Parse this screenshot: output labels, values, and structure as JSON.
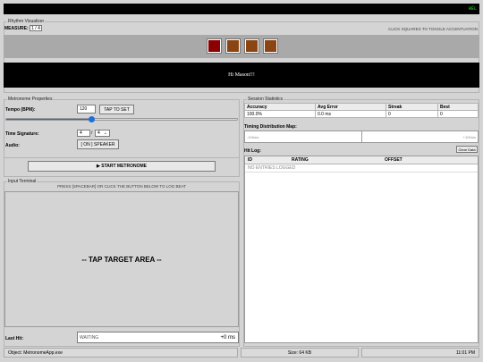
{
  "window": {
    "top_status": "RÉL"
  },
  "visualizer": {
    "title": "Rhythm Visualizer",
    "measure_label": "MEASURE:",
    "measure_value": "1 / 4",
    "hint": "CLICK SQUARES TO TOGGLE ACCENTUATION",
    "squares": [
      {
        "color": "#8b0000"
      },
      {
        "color": "#8b4513"
      },
      {
        "color": "#8b4513"
      },
      {
        "color": "#8b4513"
      }
    ],
    "message": "Hi Mason!!!"
  },
  "metronome": {
    "title": "Metronome Properties",
    "tempo_label": "Tempo (BPM):",
    "tempo_value": "120",
    "tap_label": "TAP TO SET",
    "tempo_fraction": 0.37,
    "timesig_label": "Time Signature:",
    "timesig_num": "4",
    "timesig_slash": "/",
    "timesig_den": "4",
    "audio_label": "Audio:",
    "audio_button": "[ ON ] SPEAKER",
    "start_button": "▶ START METRONOME"
  },
  "terminal": {
    "title": "Input Terminal",
    "hint": "PRESS [SPACEBAR] OR CLICK THE BUTTON BELOW TO LOG BEAT",
    "tap_area": "-- TAP TARGET AREA --",
    "last_hit_label": "Last Hit:",
    "last_hit_value": "WAITING",
    "offset_value": "+0",
    "offset_unit": "ms"
  },
  "stats": {
    "title": "Session Statistics",
    "headers": [
      "Accuracy",
      "Avg Error",
      "Streak",
      "Best"
    ],
    "values": [
      "100.0%",
      "0.0 ms",
      "0",
      "0"
    ],
    "timing_title": "Timing Distribution Map:",
    "timing_left": "-100ms",
    "timing_right": "+100ms",
    "hitlog_title": "Hit Log:",
    "clear_label": "Clear Data",
    "log_headers": [
      "ID",
      "RATING",
      "OFFSET"
    ],
    "log_empty": "NO ENTRIES LOGGED"
  },
  "statusbar": {
    "object": "Object: MetronomeApp.exe",
    "size": "Size: 64 KB",
    "time": "11:01 PM"
  },
  "colors": {
    "accent": "#1e6fd9",
    "terminal_text": "#33dd33"
  }
}
